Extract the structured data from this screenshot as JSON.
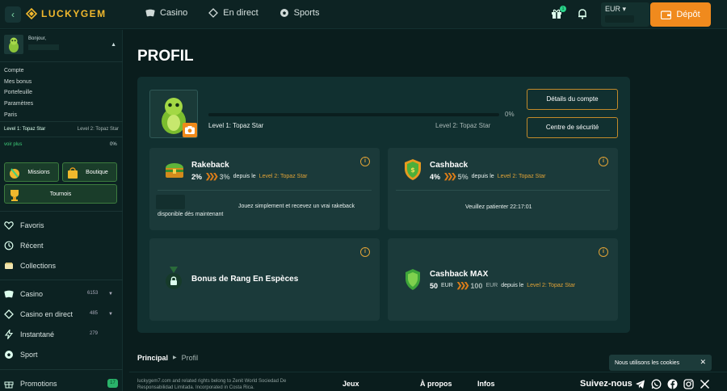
{
  "brand": {
    "name": "LUCKYGEM",
    "accent": "#f1b82d",
    "cta": "#f08a1d",
    "success": "#3ed17e"
  },
  "nav": {
    "items": [
      "Casino",
      "En direct",
      "Sports"
    ]
  },
  "header": {
    "gift_badge": "1",
    "currency": "EUR",
    "deposit_label": "Dépôt"
  },
  "sidebar": {
    "greeting": "Bonjour,",
    "links": [
      "Compte",
      "Mes bonus",
      "Portefeuille",
      "Paramètres",
      "Paris"
    ],
    "level_current": "Level 1: Topaz Star",
    "level_next": "Level 2: Topaz Star",
    "see_more": "voir plus",
    "progress_pct": "0%",
    "tiles": {
      "missions": "Missions",
      "shop": "Boutique",
      "tournaments": "Tournois"
    },
    "menu": {
      "favorites": "Favoris",
      "recent": "Récent",
      "collections": "Collections",
      "casino": "Casino",
      "casino_count": "6153",
      "live_casino": "Casino en direct",
      "live_count": "485",
      "instant": "Instantané",
      "instant_count": "279",
      "sport": "Sport",
      "promotions": "Promotions",
      "promo_count": "17"
    }
  },
  "profile": {
    "title": "PROFIL",
    "progress_value": 0,
    "progress_pct": "0%",
    "level_current": "Level 1: Topaz Star",
    "level_next": "Level 2: Topaz Star",
    "account_btn": "Détails du compte",
    "security_btn": "Centre de sécurité",
    "rakeback": {
      "title": "Rakeback",
      "current": "2%",
      "next": "3%",
      "since": "depuis le",
      "level": "Level 2: Topaz Star",
      "message_1": "Jouez simplement et recevez un vrai rakeback",
      "message_2": "disponible dès maintenant"
    },
    "cashback": {
      "title": "Cashback",
      "current": "4%",
      "next": "5%",
      "since": "depuis le",
      "level": "Level 2: Topaz Star",
      "wait": "Veuillez patienter 22:17:01"
    },
    "rank_bonus": {
      "title": "Bonus de Rang En Espèces"
    },
    "cashback_max": {
      "title": "Cashback MAX",
      "current": "50",
      "current_unit": "EUR",
      "next": "100",
      "next_unit": "EUR",
      "since": "depuis le",
      "level": "Level 2: Topaz Star"
    }
  },
  "breadcrumb": {
    "home": "Principal",
    "current": "Profil"
  },
  "footer": {
    "legal_1": "luckygem7.com and related rights belong to Zenit World Sociedad De",
    "legal_2": "Responsabilidad Limitada. Incorporated in Costa Rica.",
    "col_games": "Jeux",
    "col_about": "À propos",
    "col_info": "Infos",
    "follow": "Suivez-nous"
  },
  "cookie": {
    "text": "Nous utilisons les cookies",
    "close": "✕"
  }
}
